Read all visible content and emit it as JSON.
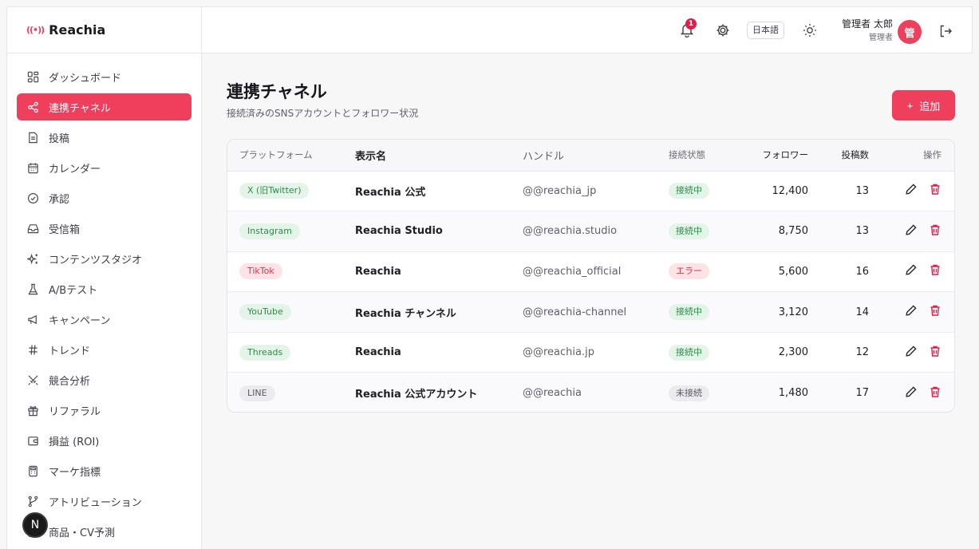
{
  "brand": {
    "icon": "((•))",
    "name": "Reachia"
  },
  "sidebar": {
    "items": [
      {
        "label": "ダッシュボード",
        "icon": "grid-icon",
        "active": false
      },
      {
        "label": "連携チャネル",
        "icon": "share-icon",
        "active": true
      },
      {
        "label": "投稿",
        "icon": "document-icon",
        "active": false
      },
      {
        "label": "カレンダー",
        "icon": "calendar-icon",
        "active": false
      },
      {
        "label": "承認",
        "icon": "check-circle-icon",
        "active": false
      },
      {
        "label": "受信箱",
        "icon": "inbox-icon",
        "active": false
      },
      {
        "label": "コンテンツスタジオ",
        "icon": "sparkles-icon",
        "active": false
      },
      {
        "label": "A/Bテスト",
        "icon": "flask-icon",
        "active": false
      },
      {
        "label": "キャンペーン",
        "icon": "megaphone-icon",
        "active": false
      },
      {
        "label": "トレンド",
        "icon": "hash-icon",
        "active": false
      },
      {
        "label": "競合分析",
        "icon": "swords-icon",
        "active": false
      },
      {
        "label": "リファラル",
        "icon": "gift-icon",
        "active": false
      },
      {
        "label": "損益 (ROI)",
        "icon": "wallet-icon",
        "active": false
      },
      {
        "label": "マーケ指標",
        "icon": "calculator-icon",
        "active": false
      },
      {
        "label": "アトリビューション",
        "icon": "branch-icon",
        "active": false
      },
      {
        "label": "商品・CV予測",
        "icon": "chart-icon",
        "active": false
      }
    ]
  },
  "overlay_badge": "N",
  "header": {
    "notification_count": "1",
    "language": "日本語",
    "user_name": "管理者 太郎",
    "user_role": "管理者",
    "avatar": "管"
  },
  "page": {
    "title": "連携チャネル",
    "subtitle": "接続済みのSNSアカウントとフォロワー状況",
    "add_button": "追加",
    "add_button_icon": "+"
  },
  "table": {
    "headers": [
      "プラットフォーム",
      "表示名",
      "ハンドル",
      "接続状態",
      "フォロワー",
      "投稿数",
      "操作"
    ],
    "rows": [
      {
        "platform": "X (旧Twitter)",
        "platform_color": "green",
        "name": "Reachia 公式",
        "handle": "@@reachia_jp",
        "status": "接続中",
        "status_color": "green",
        "followers": "12,400",
        "posts": "13"
      },
      {
        "platform": "Instagram",
        "platform_color": "green",
        "name": "Reachia Studio",
        "handle": "@@reachia.studio",
        "status": "接続中",
        "status_color": "green",
        "followers": "8,750",
        "posts": "13"
      },
      {
        "platform": "TikTok",
        "platform_color": "red",
        "name": "Reachia",
        "handle": "@@reachia_official",
        "status": "エラー",
        "status_color": "red",
        "followers": "5,600",
        "posts": "16"
      },
      {
        "platform": "YouTube",
        "platform_color": "green",
        "name": "Reachia チャンネル",
        "handle": "@@reachia-channel",
        "status": "接続中",
        "status_color": "green",
        "followers": "3,120",
        "posts": "14"
      },
      {
        "platform": "Threads",
        "platform_color": "green",
        "name": "Reachia",
        "handle": "@@reachia.jp",
        "status": "接続中",
        "status_color": "green",
        "followers": "2,300",
        "posts": "12"
      },
      {
        "platform": "LINE",
        "platform_color": "gray",
        "name": "Reachia 公式アカウント",
        "handle": "@@reachia",
        "status": "未接続",
        "status_color": "gray",
        "followers": "1,480",
        "posts": "17"
      }
    ]
  },
  "colors": {
    "accent": "#ee3f5d",
    "danger": "#e11d48"
  }
}
